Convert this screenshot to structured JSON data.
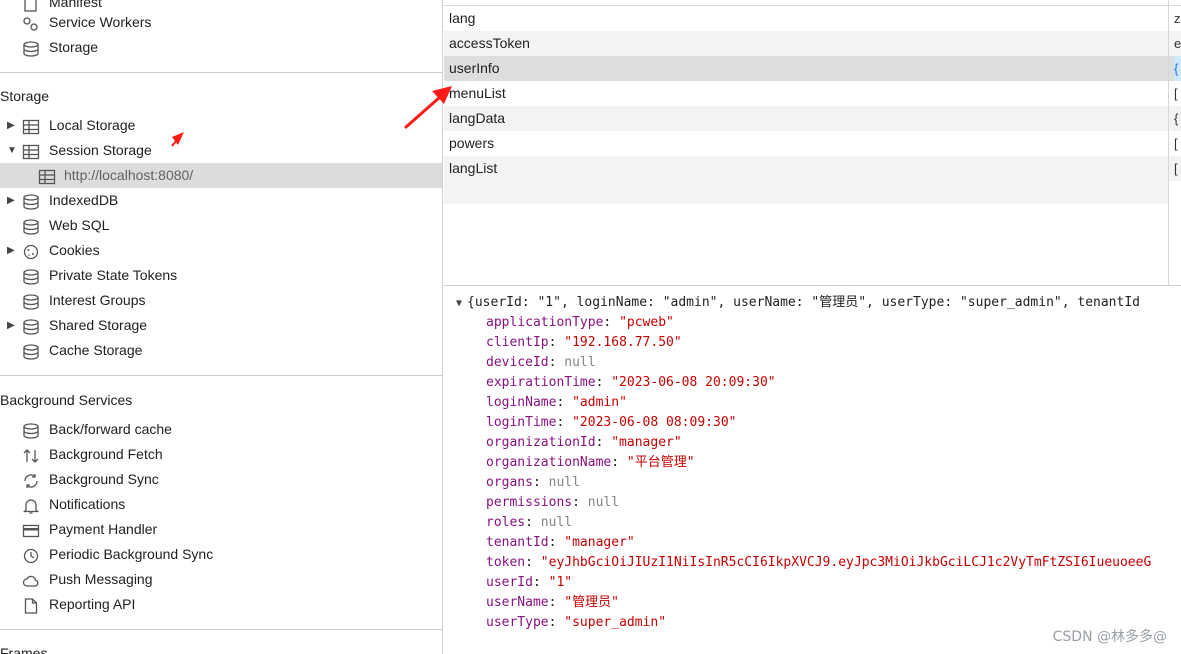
{
  "sidebar": {
    "top_items": [
      {
        "label": "Manifest",
        "icon": "document-icon"
      },
      {
        "label": "Service Workers",
        "icon": "gears-icon"
      },
      {
        "label": "Storage",
        "icon": "database-icon"
      }
    ],
    "storage_section": {
      "title": "Storage",
      "items": [
        {
          "label": "Local Storage",
          "expand": "▶"
        },
        {
          "label": "Session Storage",
          "expand": "▼"
        },
        {
          "label": "http://localhost:8080/"
        },
        {
          "label": "IndexedDB",
          "expand": "▶"
        },
        {
          "label": "Web SQL"
        },
        {
          "label": "Cookies",
          "expand": "▶"
        },
        {
          "label": "Private State Tokens"
        },
        {
          "label": "Interest Groups"
        },
        {
          "label": "Shared Storage",
          "expand": "▶"
        },
        {
          "label": "Cache Storage"
        }
      ]
    },
    "background_section": {
      "title": "Background Services",
      "items": [
        {
          "label": "Back/forward cache"
        },
        {
          "label": "Background Fetch"
        },
        {
          "label": "Background Sync"
        },
        {
          "label": "Notifications"
        },
        {
          "label": "Payment Handler"
        },
        {
          "label": "Periodic Background Sync"
        },
        {
          "label": "Push Messaging"
        },
        {
          "label": "Reporting API"
        }
      ]
    },
    "frames_section": {
      "title": "Frames"
    }
  },
  "kv_table": {
    "rows": [
      {
        "key": "lang",
        "value": "z"
      },
      {
        "key": "accessToken",
        "value": "e"
      },
      {
        "key": "userInfo",
        "value": "{"
      },
      {
        "key": "menuList",
        "value": "["
      },
      {
        "key": "langData",
        "value": "{"
      },
      {
        "key": "powers",
        "value": "["
      },
      {
        "key": "langList",
        "value": "["
      }
    ]
  },
  "json_view": {
    "expand": "▼",
    "summary": "{userId: \"1\", loginName: \"admin\", userName: \"管理员\", userType: \"super_admin\", tenantId",
    "props": [
      {
        "key": "applicationType",
        "value": "\"pcweb\"",
        "type": "str"
      },
      {
        "key": "clientIp",
        "value": "\"192.168.77.50\"",
        "type": "str"
      },
      {
        "key": "deviceId",
        "value": "null",
        "type": "nul"
      },
      {
        "key": "expirationTime",
        "value": "\"2023-06-08 20:09:30\"",
        "type": "str"
      },
      {
        "key": "loginName",
        "value": "\"admin\"",
        "type": "str"
      },
      {
        "key": "loginTime",
        "value": "\"2023-06-08 08:09:30\"",
        "type": "str"
      },
      {
        "key": "organizationId",
        "value": "\"manager\"",
        "type": "str"
      },
      {
        "key": "organizationName",
        "value": "\"平台管理\"",
        "type": "str"
      },
      {
        "key": "organs",
        "value": "null",
        "type": "nul"
      },
      {
        "key": "permissions",
        "value": "null",
        "type": "nul"
      },
      {
        "key": "roles",
        "value": "null",
        "type": "nul"
      },
      {
        "key": "tenantId",
        "value": "\"manager\"",
        "type": "str"
      },
      {
        "key": "token",
        "value": "\"eyJhbGciOiJIUzI1NiIsInR5cCI6IkpXVCJ9.eyJpc3MiOiJkbGciLCJ1c2VyTmFtZSI6IueuoeeG",
        "type": "str"
      },
      {
        "key": "userId",
        "value": "\"1\"",
        "type": "str"
      },
      {
        "key": "userName",
        "value": "\"管理员\"",
        "type": "str"
      },
      {
        "key": "userType",
        "value": "\"super_admin\"",
        "type": "str"
      }
    ]
  },
  "watermark": "CSDN @林多多@",
  "colors": {
    "annotation_arrow": "#ff1a1a",
    "selection": "#dcdcdc",
    "string": "#c80000",
    "key": "#881280"
  }
}
